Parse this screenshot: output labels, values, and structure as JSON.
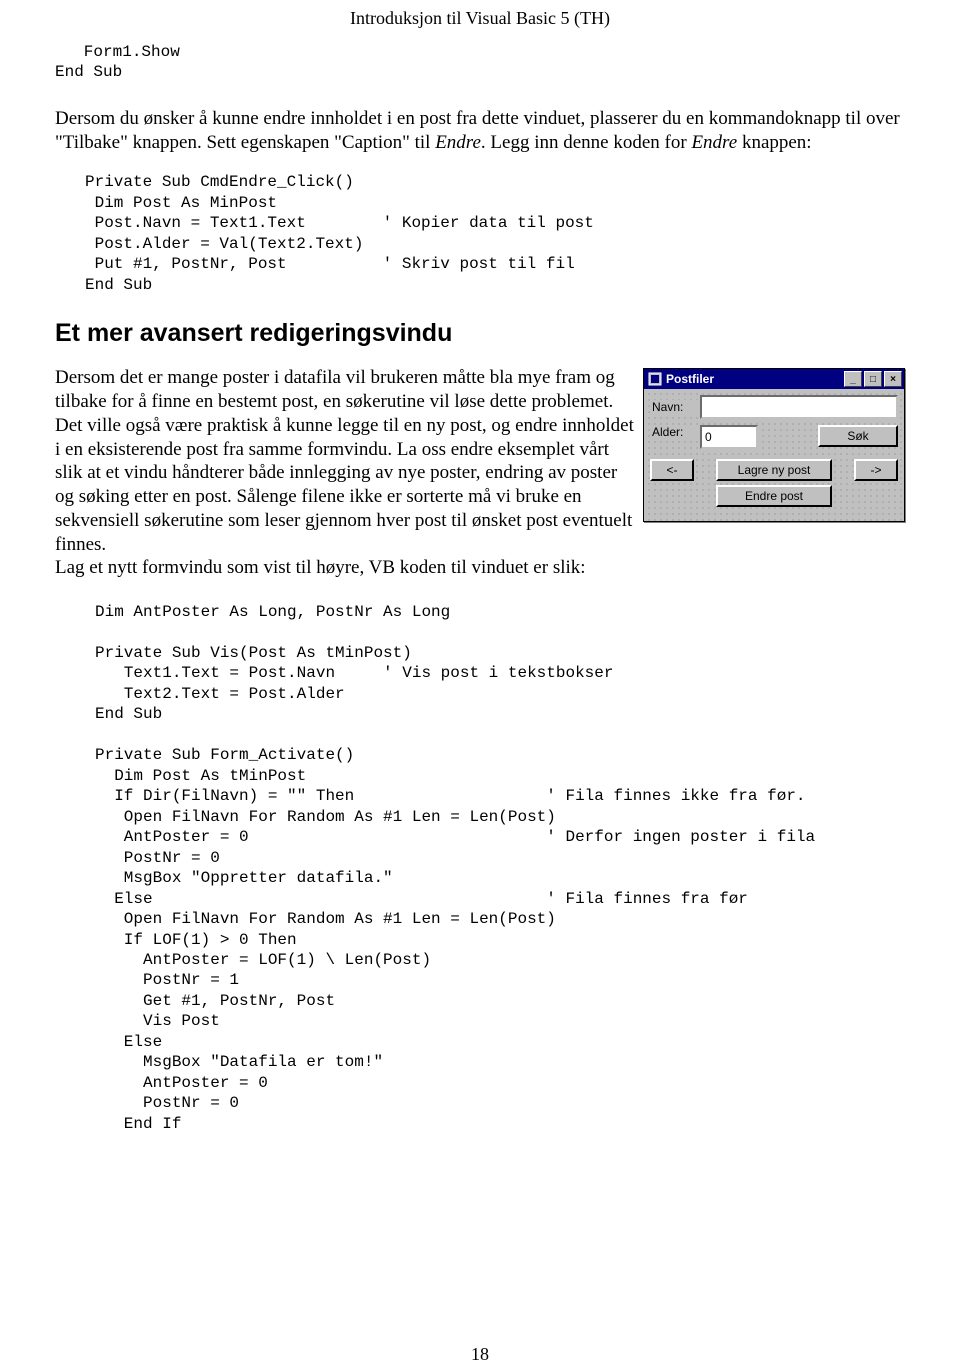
{
  "header": {
    "title": "Introduksjon til Visual Basic 5 (TH)"
  },
  "page_number": "18",
  "code_top": "   Form1.Show\nEnd Sub",
  "para1": {
    "lead": "  Dersom du ønsker å kunne endre innholdet i en post fra dette vinduet, plasserer du en kommandoknapp til over \"Tilbake\" knappen. Sett egenskapen \"Caption\" til ",
    "italic1": "Endre",
    "mid": ". Legg inn denne koden for ",
    "italic2": "Endre",
    "tail": " knappen:"
  },
  "code_mid": "Private Sub CmdEndre_Click()\n Dim Post As MinPost\n Post.Navn = Text1.Text        ' Kopier data til post\n Post.Alder = Val(Text2.Text)\n Put #1, PostNr, Post          ' Skriv post til fil\nEnd Sub",
  "h2": "Et mer avansert redigeringsvindu",
  "para2": "Dersom det er mange poster i datafila vil brukeren måtte bla mye fram og tilbake for å finne en bestemt post, en søkerutine vil løse dette problemet. Det ville også være praktisk å kunne legge til en ny post, og endre innholdet i en eksisterende post fra samme formvindu.  La oss endre eksemplet vårt slik at et vindu håndterer både innlegging av nye poster, endring av poster og søking etter en post. Sålenge filene ikke er sorterte må vi bruke en sekvensiell søkerutine som leser gjennom hver post til ønsket post eventuelt finnes.",
  "para2b": "  Lag et nytt formvindu som vist til høyre, VB koden til vinduet er slik:",
  "window": {
    "title": "Postfiler",
    "label_navn": "Navn:",
    "label_alder": "Alder:",
    "value_alder": "0",
    "btn_sok": "Søk",
    "btn_lagre": "Lagre ny post",
    "btn_endre": "Endre post",
    "btn_prev": "<-",
    "btn_next": "->",
    "min_glyph": "_",
    "max_glyph": "□",
    "close_glyph": "×"
  },
  "code_bot": "Dim AntPoster As Long, PostNr As Long\n\nPrivate Sub Vis(Post As tMinPost)\n   Text1.Text = Post.Navn     ' Vis post i tekstbokser\n   Text2.Text = Post.Alder\nEnd Sub\n\nPrivate Sub Form_Activate()\n  Dim Post As tMinPost\n  If Dir(FilNavn) = \"\" Then                    ' Fila finnes ikke fra før.\n   Open FilNavn For Random As #1 Len = Len(Post)\n   AntPoster = 0                               ' Derfor ingen poster i fila\n   PostNr = 0\n   MsgBox \"Oppretter datafila.\"\n  Else                                         ' Fila finnes fra før\n   Open FilNavn For Random As #1 Len = Len(Post)\n   If LOF(1) > 0 Then\n     AntPoster = LOF(1) \\ Len(Post)\n     PostNr = 1\n     Get #1, PostNr, Post\n     Vis Post\n   Else\n     MsgBox \"Datafila er tom!\"\n     AntPoster = 0\n     PostNr = 0\n   End If"
}
